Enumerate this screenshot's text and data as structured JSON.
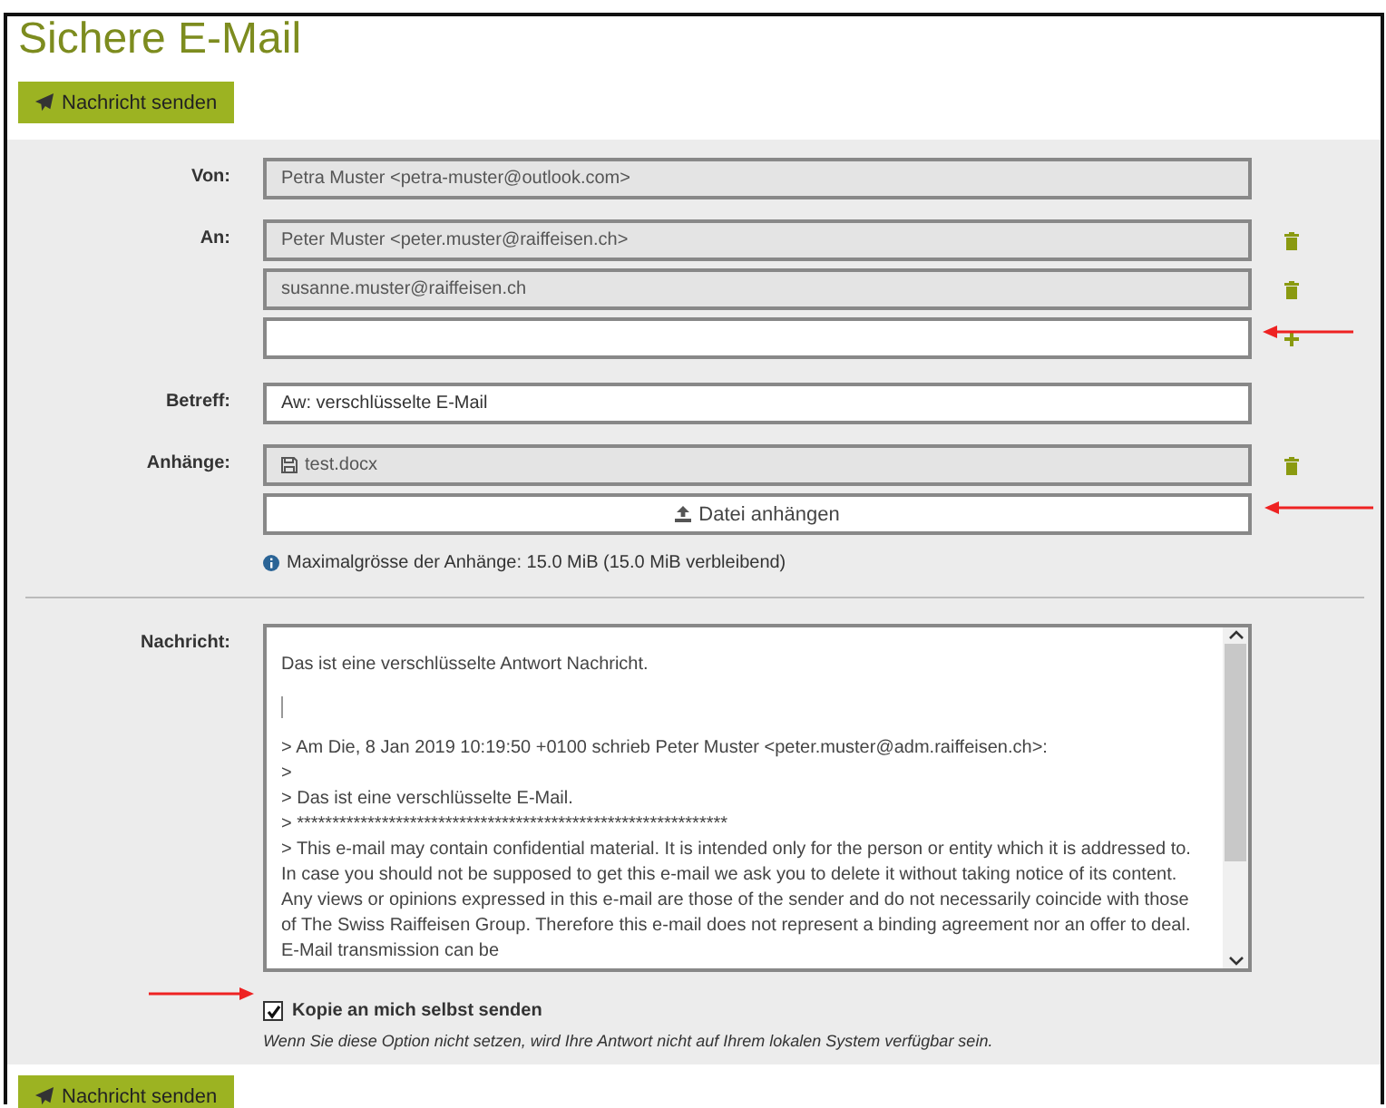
{
  "title": "Sichere E-Mail",
  "send_button_top": "Nachricht senden",
  "from": {
    "label": "Von:",
    "value": "Petra Muster <petra-muster@outlook.com>",
    "readonly": true
  },
  "to": {
    "label": "An:",
    "recipients": [
      {
        "value": "Peter Muster <peter.muster@raiffeisen.ch>",
        "readonly": true
      },
      {
        "value": "susanne.muster@raiffeisen.ch",
        "readonly": true
      }
    ]
  },
  "subject": {
    "label": "Betreff:",
    "value": "Aw: verschlüsselte E-Mail",
    "readonly": false
  },
  "attachments": {
    "label": "Anhänge:",
    "files": [
      {
        "name": "test.docx"
      }
    ],
    "attach_button": "Datei anhängen",
    "limit_note": "Maximalgrösse der Anhänge: 15.0 MiB (15.0 MiB verbleibend)"
  },
  "message": {
    "label": "Nachricht:",
    "reply": "Das ist eine verschlüsselte Antwort Nachricht.",
    "quoted_lines": [
      "> Am Die,  8 Jan 2019 10:19:50 +0100 schrieb Peter Muster <peter.muster@adm.raiffeisen.ch>:",
      ">",
      "> Das ist eine verschlüsselte E-Mail.",
      "> *************************************************************",
      "> This e-mail may contain confidential material. It is intended only for the person or entity which it is addressed to. In case you should not be supposed to get this e-mail we ask you to delete it without taking notice of its content. Any views or opinions expressed in this e-mail are those of the sender and do not necessarily coincide with those of The Swiss Raiffeisen Group. Therefore this e-mail does not represent a binding agreement nor an offer to deal. E-Mail transmission can be"
    ]
  },
  "copy_option": {
    "label": "Kopie an mich selbst senden",
    "checked": true,
    "hint": "Wenn Sie diese Option nicht setzen, wird Ihre Antwort nicht auf Ihrem lokalen System verfügbar sein."
  },
  "send_button_bottom": "Nachricht senden"
}
